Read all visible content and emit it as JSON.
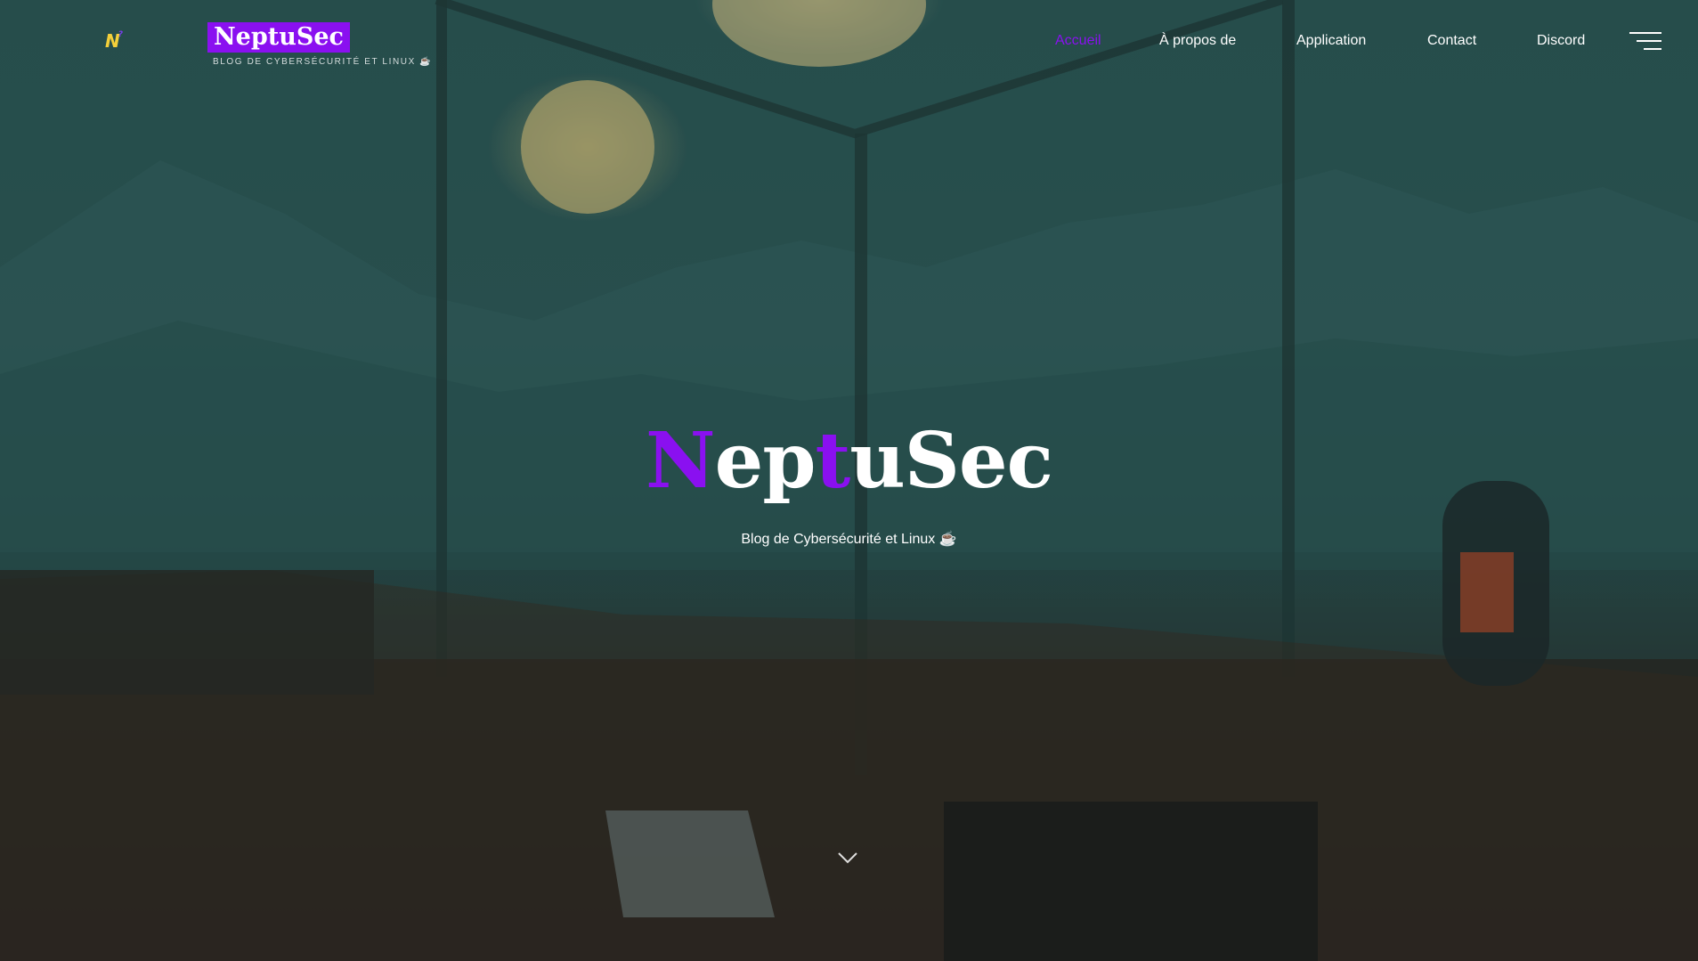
{
  "header": {
    "logo_mark": {
      "first": "N",
      "second": "?"
    },
    "brand_name": "NeptuSec",
    "tagline": "BLOG DE CYBERSÉCURITÉ ET LINUX ☕"
  },
  "nav": {
    "items": [
      {
        "label": "Accueil",
        "active": true
      },
      {
        "label": "À propos de",
        "active": false
      },
      {
        "label": "Application",
        "active": false
      },
      {
        "label": "Contact",
        "active": false
      },
      {
        "label": "Discord",
        "active": false
      }
    ],
    "menu_icon": "hamburger-icon"
  },
  "hero": {
    "title_parts": [
      "N",
      "ep",
      "t",
      "uSec"
    ],
    "subtitle": "Blog de Cybersécurité et Linux ☕",
    "scroll_icon": "chevron-down-icon"
  },
  "colors": {
    "accent": "#8a10f0",
    "logo_yellow": "#f4cf3a",
    "text": "#ffffff"
  }
}
